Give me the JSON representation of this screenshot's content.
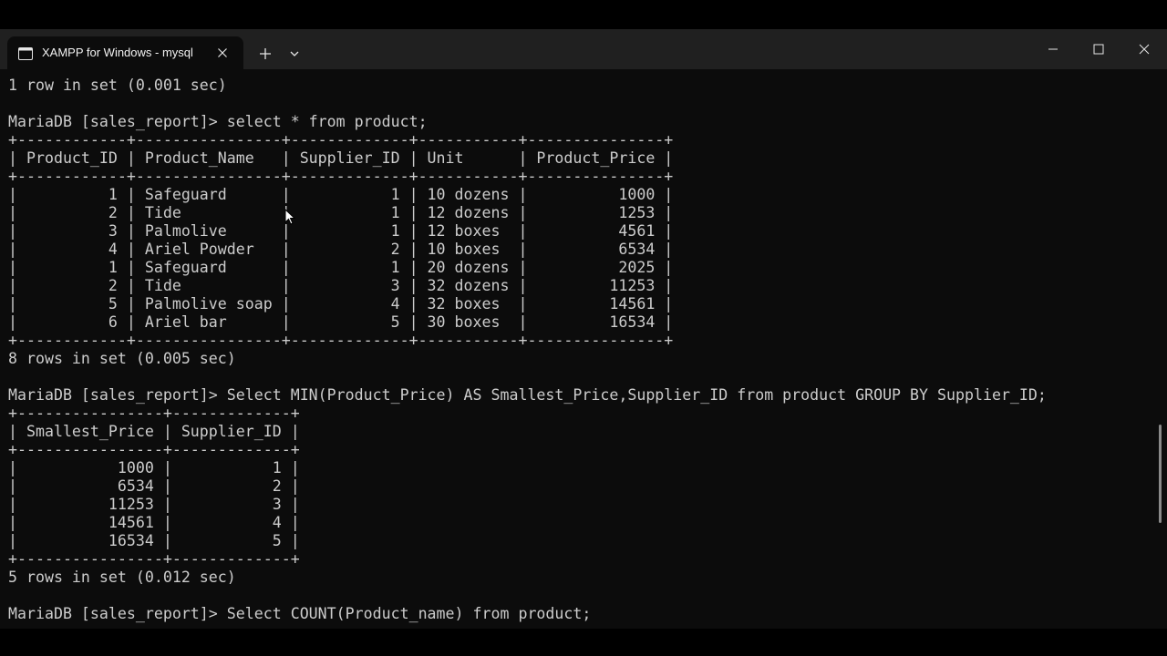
{
  "window": {
    "tab_title": "XAMPP for Windows - mysql"
  },
  "terminal": {
    "lines": [
      "1 row in set (0.001 sec)",
      "",
      "MariaDB [sales_report]> select * from product;",
      "+------------+----------------+-------------+-----------+---------------+",
      "| Product_ID | Product_Name   | Supplier_ID | Unit      | Product_Price |",
      "+------------+----------------+-------------+-----------+---------------+",
      "|          1 | Safeguard      |           1 | 10 dozens |          1000 |",
      "|          2 | Tide           |           1 | 12 dozens |          1253 |",
      "|          3 | Palmolive      |           1 | 12 boxes  |          4561 |",
      "|          4 | Ariel Powder   |           2 | 10 boxes  |          6534 |",
      "|          1 | Safeguard      |           1 | 20 dozens |          2025 |",
      "|          2 | Tide           |           3 | 32 dozens |         11253 |",
      "|          5 | Palmolive soap |           4 | 32 boxes  |         14561 |",
      "|          6 | Ariel bar      |           5 | 30 boxes  |         16534 |",
      "+------------+----------------+-------------+-----------+---------------+",
      "8 rows in set (0.005 sec)",
      "",
      "MariaDB [sales_report]> Select MIN(Product_Price) AS Smallest_Price,Supplier_ID from product GROUP BY Supplier_ID;",
      "+----------------+-------------+",
      "| Smallest_Price | Supplier_ID |",
      "+----------------+-------------+",
      "|           1000 |           1 |",
      "|           6534 |           2 |",
      "|          11253 |           3 |",
      "|          14561 |           4 |",
      "|          16534 |           5 |",
      "+----------------+-------------+",
      "5 rows in set (0.012 sec)",
      "",
      "MariaDB [sales_report]> Select COUNT(Product_name) from product;"
    ]
  },
  "icons": {
    "tab_icon": "terminal-icon",
    "tab_close": "close-icon",
    "new_tab": "plus-icon",
    "dropdown": "chevron-down-icon",
    "minimize": "minimize-icon",
    "maximize": "maximize-icon",
    "close": "close-icon",
    "cursor": "mouse-pointer-icon"
  },
  "colors": {
    "titlebar": "#202020",
    "terminal_bg": "#0c0c0c",
    "text": "#cccccc"
  }
}
